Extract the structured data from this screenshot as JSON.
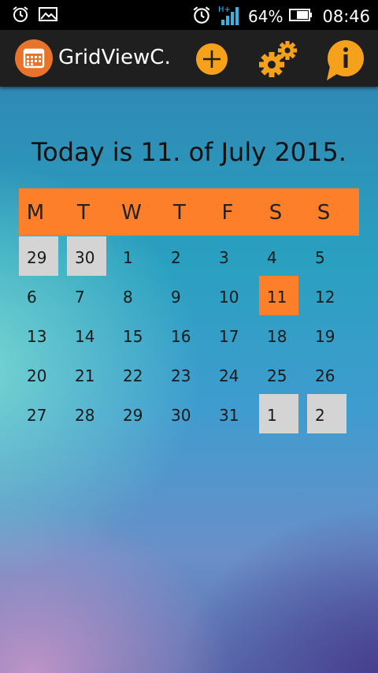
{
  "status_bar": {
    "battery_percent": "64%",
    "time": "08:46",
    "network": "H+"
  },
  "action_bar": {
    "title": "GridViewC…",
    "icons": [
      "calendar-icon",
      "add-icon",
      "settings-icon",
      "info-icon"
    ],
    "accent": "#f5a11c"
  },
  "calendar": {
    "today_text": "Today is 11. of July 2015.",
    "weekdays": [
      "M",
      "T",
      "W",
      "T",
      "F",
      "S",
      "S"
    ],
    "header_color": "#fd7f2a",
    "weeks": [
      [
        "29",
        "30",
        "1",
        "2",
        "3",
        "4",
        "5"
      ],
      [
        "6",
        "7",
        "8",
        "9",
        "10",
        "11",
        "12"
      ],
      [
        "13",
        "14",
        "15",
        "16",
        "17",
        "18",
        "19"
      ],
      [
        "20",
        "21",
        "22",
        "23",
        "24",
        "25",
        "26"
      ],
      [
        "27",
        "28",
        "29",
        "30",
        "31",
        "1",
        "2"
      ]
    ],
    "other_month_cells": [
      [
        0,
        0
      ],
      [
        0,
        1
      ],
      [
        4,
        5
      ],
      [
        4,
        6
      ]
    ],
    "today_cell": [
      1,
      5
    ]
  }
}
